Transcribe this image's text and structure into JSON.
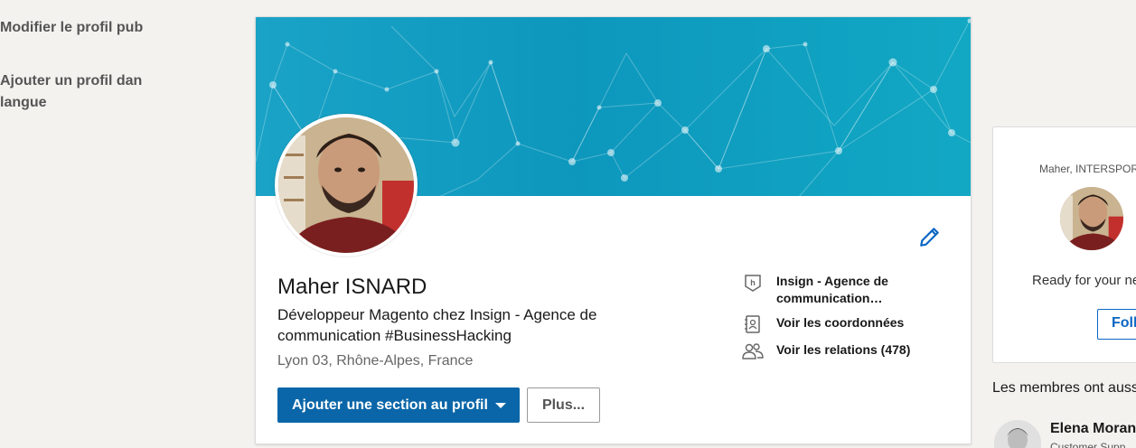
{
  "profile": {
    "name": "Maher ISNARD",
    "headline": "Développeur Magento chez Insign - Agence de communication #BusinessHacking",
    "location": "Lyon 03, Rhône-Alpes, France",
    "primary_button_label": "Ajouter une section au profil",
    "secondary_button_label": "Plus...",
    "side_links": [
      {
        "icon": "company-logo-icon",
        "label": "Insign - Agence de communication…"
      },
      {
        "icon": "contact-card-icon",
        "label": "Voir les coordonnées"
      },
      {
        "icon": "people-icon",
        "label": "Voir les relations (478)"
      }
    ]
  },
  "right_column": {
    "link_edit_public": "Modifier le profil pub",
    "link_add_language": "Ajouter un profil dan langue",
    "ad": {
      "caption": "Maher, INTERSPORT",
      "text": "Ready for your ne",
      "follow_label": "Foll"
    },
    "members_title": "Les membres ont auss",
    "member": {
      "name": "Elena Moran",
      "subtitle": "Customer Supp"
    }
  },
  "colors": {
    "accent": "#0a66a8",
    "banner": "#12a0c4",
    "page_bg": "#f3f2ef"
  }
}
